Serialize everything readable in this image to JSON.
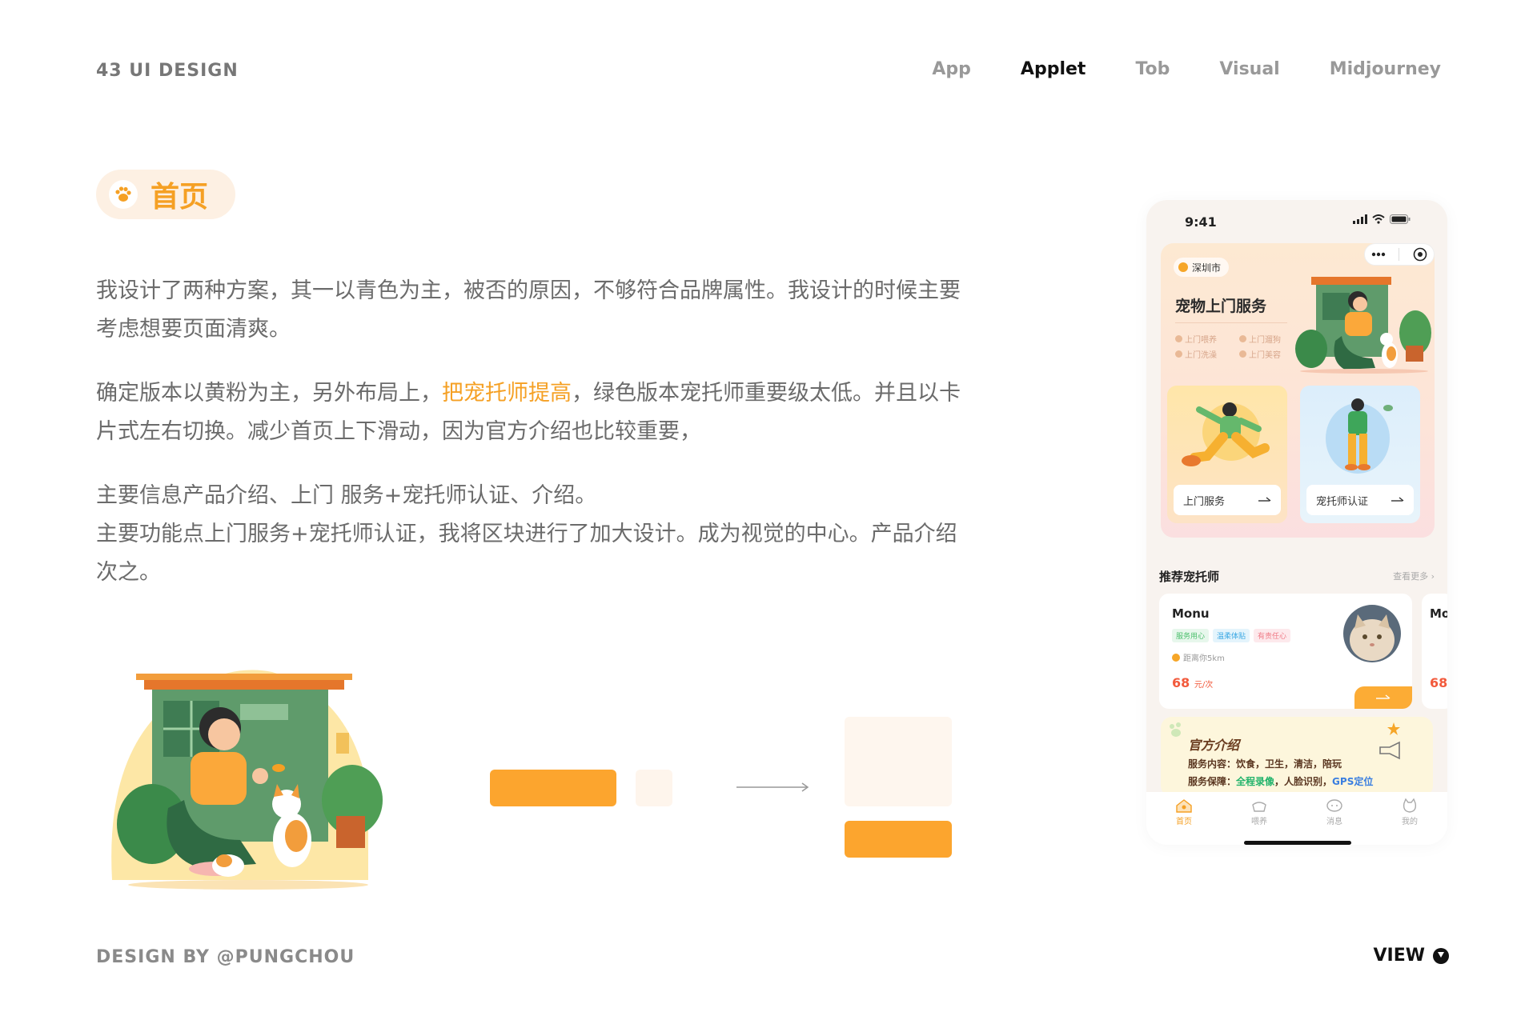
{
  "brand": "43  UI  DESIGN",
  "nav": [
    {
      "label": "App",
      "active": false
    },
    {
      "label": "Applet",
      "active": true
    },
    {
      "label": "Tob",
      "active": false
    },
    {
      "label": "Visual",
      "active": false
    },
    {
      "label": "Midjourney",
      "active": false
    }
  ],
  "section": {
    "title": "首页"
  },
  "description": {
    "p1": "我设计了两种方案，其一以青色为主，被否的原因，不够符合品牌属性。我设计的时候主要考虑想要页面清爽。",
    "p2_before": "确定版本以黄粉为主，另外布局上，",
    "p2_highlight": "把宠托师提高",
    "p2_after": "，绿色版本宠托师重要级太低。并且以卡片式左右切换。减少首页上下滑动，因为官方介绍也比较重要，",
    "p3_line1": "主要信息产品介绍、上门 服务+宠托师认证、介绍。",
    "p3_line2": "主要功能点上门服务+宠托师认证，我将区块进行了加大设计。成为视觉的中心。产品介绍次之。"
  },
  "footer": {
    "credit": "DESIGN  BY  @PUNGCHOU",
    "view": "VIEW"
  },
  "colors": {
    "accent": "#f5a024",
    "orange_block": "#fca52e",
    "light_block": "#fef5ec"
  },
  "phone": {
    "status_time": "9:41",
    "location": "深圳市",
    "hero_title": "宠物上门服务",
    "services": [
      "上门喂养",
      "上门遛狗",
      "上门洗澡",
      "上门美容"
    ],
    "card_a": "上门服务",
    "card_b": "宠托师认证",
    "recommend_title": "推荐宠托师",
    "recommend_more": "查看更多 ›",
    "sitter": {
      "name": "Monu",
      "tags": [
        "服务用心",
        "温柔体贴",
        "有责任心"
      ],
      "distance": "距离你5km",
      "price": "68",
      "unit": "元/次"
    },
    "peek": {
      "name": "Mo",
      "price": "68"
    },
    "intro": {
      "title": "官方介绍",
      "line1": "服务内容：饮食，卫生，清洁，陪玩",
      "line2_prefix": "服务保障：",
      "line2_green": "全程录像",
      "line2_mid": "，人脸识别，",
      "line2_blue": "GPS定位"
    },
    "tabs": [
      {
        "label": "首页",
        "icon": "home-icon",
        "active": true
      },
      {
        "label": "喂养",
        "icon": "bowl-icon",
        "active": false
      },
      {
        "label": "消息",
        "icon": "message-icon",
        "active": false
      },
      {
        "label": "我的",
        "icon": "profile-icon",
        "active": false
      }
    ]
  }
}
